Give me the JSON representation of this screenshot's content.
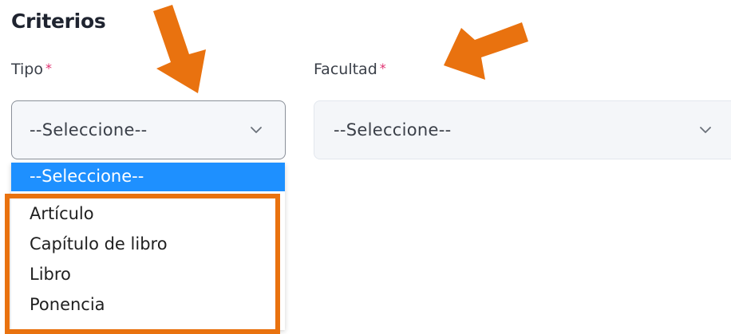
{
  "section": {
    "title": "Criterios"
  },
  "fields": {
    "tipo": {
      "label": "Tipo",
      "required_mark": "*",
      "selected": "--Seleccione--"
    },
    "facultad": {
      "label": "Facultad",
      "required_mark": "*",
      "selected": "--Seleccione--"
    }
  },
  "dropdown": {
    "options": [
      "--Seleccione--",
      "Artículo",
      "Capítulo de libro",
      "Libro",
      "Ponencia"
    ],
    "highlighted_index": 0
  },
  "icons": {
    "select_chevron": "chevron-down-icon",
    "annotation_arrow": "arrow-icon"
  },
  "colors": {
    "annotation": "#e9720f",
    "required": "#e0306f",
    "option_highlight": "#1e90ff"
  }
}
